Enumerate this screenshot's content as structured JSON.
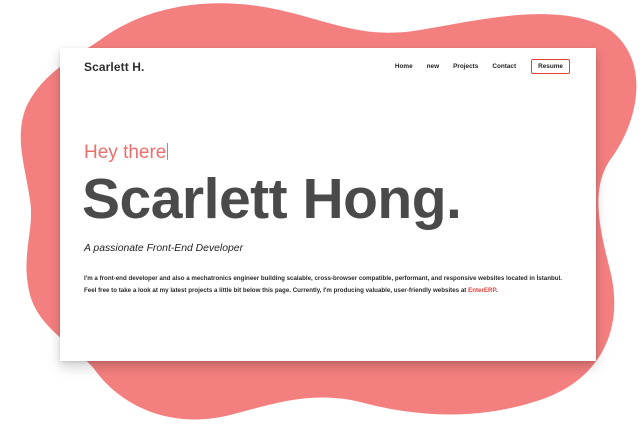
{
  "header": {
    "brand": "Scarlett H.",
    "nav": {
      "home": "Home",
      "new": "new",
      "projects": "Projects",
      "contact": "Contact",
      "resume": "Resume"
    }
  },
  "hero": {
    "greeting": "Hey there",
    "name": "Scarlett Hong.",
    "tagline": "A passionate Front-End Developer",
    "bio_before": "I'm a front-end developer and also a mechatronics engineer building scalable, cross-browser compatible, performant, and responsive websites located in İstanbul. Feel free to take a look at my latest projects a little bit below this page. Currently, I'm producing valuable, user-friendly websites at ",
    "bio_link": "EnterERP",
    "bio_after": "."
  },
  "colors": {
    "accent": "#ec6f6d",
    "blob": "#f47f7f",
    "link": "#e2413b",
    "heading": "#4a4a4a"
  }
}
